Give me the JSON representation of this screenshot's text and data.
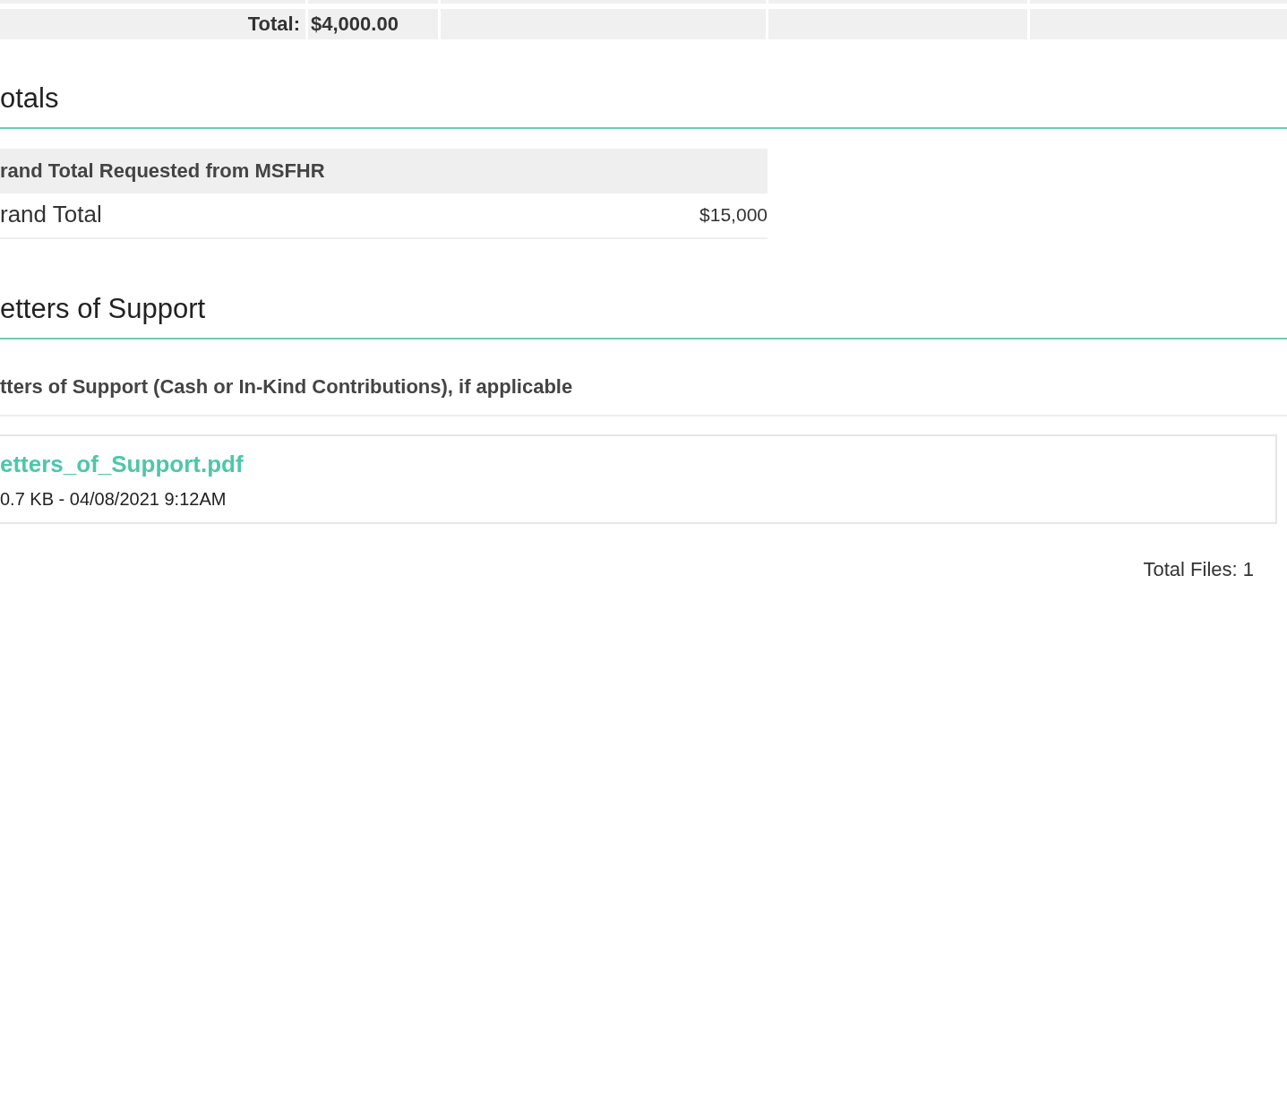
{
  "budget_total_row": {
    "label": "Total:",
    "amount": "$4,000.00"
  },
  "sections": [
    {
      "kind": "totals",
      "title": "otals",
      "table": {
        "header": "rand Total Requested from MSFHR",
        "rows": [
          {
            "label": "rand Total",
            "value": "$15,000"
          }
        ]
      }
    },
    {
      "kind": "files",
      "title": "etters of Support",
      "field_label": "tters of Support (Cash or In-Kind Contributions), if applicable",
      "files": [
        {
          "name": "etters_of_Support.pdf",
          "meta": "0.7 KB - 04/08/2021 9:12AM"
        }
      ],
      "total_files": "Total Files: 1"
    }
  ]
}
